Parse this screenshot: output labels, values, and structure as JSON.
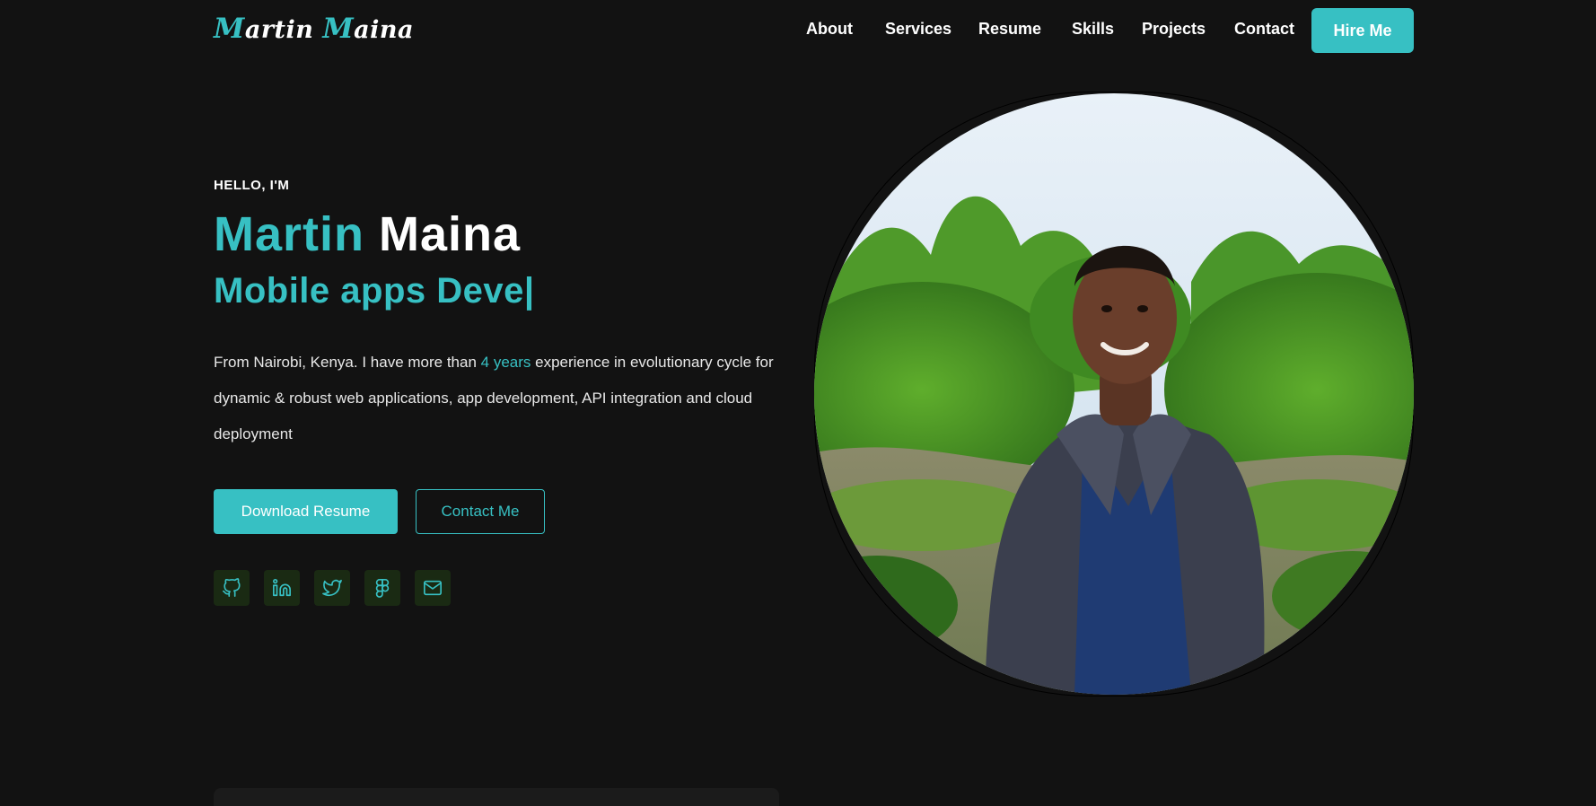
{
  "header": {
    "logo_first_cap": "M",
    "logo_first_rest": "artin",
    "logo_last_cap": "M",
    "logo_last_rest": "aina",
    "nav": {
      "about": "About",
      "services": "Services",
      "resume": "Resume",
      "skills": "Skills",
      "projects": "Projects",
      "contact": "Contact"
    },
    "hire_label": "Hire Me"
  },
  "hero": {
    "greeting": "HELLO, I'M",
    "first_name": "Martin",
    "last_name": "Maina",
    "role_typed": "Mobile apps Deve|",
    "bio_before": "From Nairobi, Kenya. I have more than ",
    "bio_highlight": "4 years",
    "bio_after": " experience in evolutionary cycle for dynamic & robust web applications, app development, API integration and cloud deployment",
    "download_label": "Download Resume",
    "contact_label": "Contact Me"
  },
  "social": [
    "github-icon",
    "linkedin-icon",
    "twitter-icon",
    "figma-icon",
    "mail-icon"
  ],
  "colors": {
    "accent": "#37c0c3",
    "background": "#121212",
    "social_bg": "#1a2a13"
  }
}
